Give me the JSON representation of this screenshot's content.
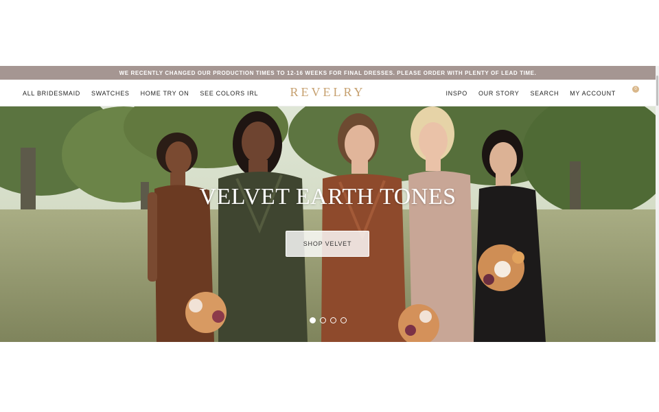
{
  "announcement": "WE RECENTLY CHANGED OUR PRODUCTION TIMES TO 12-16 WEEKS FOR FINAL DRESSES. PLEASE ORDER WITH PLENTY OF LEAD TIME.",
  "nav": {
    "left": [
      "ALL BRIDESMAID",
      "SWATCHES",
      "HOME TRY ON",
      "SEE COLORS IRL"
    ],
    "right": [
      "INSPO",
      "OUR STORY",
      "SEARCH",
      "MY ACCOUNT"
    ],
    "logo": "REVELRY",
    "cart_count": "0"
  },
  "hero": {
    "title": "VELVET EARTH TONES",
    "button": "SHOP VELVET",
    "slides": 4,
    "active_slide": 1,
    "dress_colors": [
      "#6b3a22",
      "#3f4530",
      "#8e4a2c",
      "#c8a696",
      "#1c1a1a"
    ]
  },
  "colors": {
    "announce_bg": "#a59692",
    "logo": "#c6a06f"
  }
}
